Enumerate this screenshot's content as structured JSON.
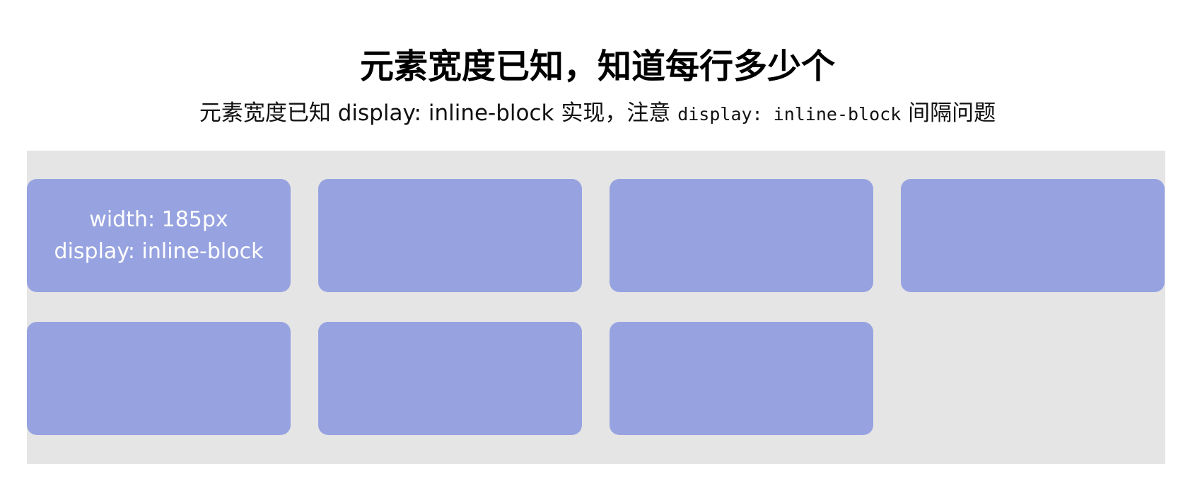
{
  "header": {
    "title": "元素宽度已知，知道每行多少个"
  },
  "description": {
    "prefix": "元素宽度已知 display: inline-block 实现，注意",
    "code": "display: inline-block",
    "suffix": "间隔问题"
  },
  "grid": {
    "row_count": 2,
    "first_box_lines": [
      "width: 185px",
      "display: inline-block"
    ],
    "colors": {
      "container_bg": "#e5e5e5",
      "box_bg": "#97a3e0",
      "box_text": "#ffffff"
    }
  }
}
